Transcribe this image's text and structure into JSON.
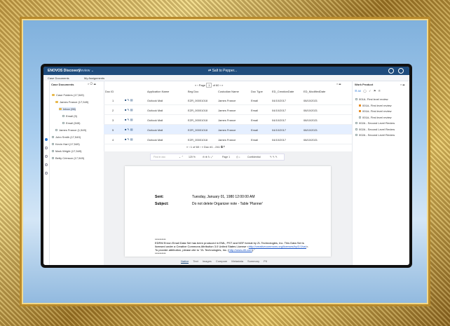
{
  "app": {
    "name": "ENOVOS Discovery",
    "review_label": "Review",
    "center_title": "Salt to Pepper..."
  },
  "tabs": [
    "Case Documents",
    "My Assignments"
  ],
  "left_panel": {
    "title": "Case Documents",
    "tree": [
      {
        "label": "Case Folders (17,549)",
        "type": "folder"
      },
      {
        "label": "James France (17,549)",
        "type": "folder"
      },
      {
        "label": "Inbox (96)",
        "type": "folder",
        "selected": true
      },
      {
        "label": "Email (9)",
        "type": "box"
      },
      {
        "label": "Email (545)",
        "type": "box"
      },
      {
        "label": "James France (1,549)",
        "type": "box"
      },
      {
        "label": "John Smith (17,549)",
        "type": "box"
      },
      {
        "label": "Kevin Hart (17,549)",
        "type": "box"
      },
      {
        "label": "Mark Wright (17,549)",
        "type": "box"
      },
      {
        "label": "Betty Crimson (17,549)",
        "type": "box"
      }
    ]
  },
  "pager_top": {
    "prefix": "Page",
    "page": "1",
    "of": "of 60"
  },
  "table": {
    "headers": [
      "Doc ID",
      "Application Name",
      "Beg Doc",
      "Custodian Name",
      "Doc Type",
      "ED_CreationDate",
      "ED_ModifiedDate"
    ],
    "rows": [
      {
        "id": "1",
        "app": "Outlook Mail",
        "beg": "EZR_00001018",
        "cust": "James France",
        "type": "Email",
        "created": "04/10/2017",
        "modified": "08/10/2021"
      },
      {
        "id": "2",
        "app": "Outlook Mail",
        "beg": "EZR_00001018",
        "cust": "James France",
        "type": "Email",
        "created": "04/10/2017",
        "modified": "08/10/2021"
      },
      {
        "id": "3",
        "app": "Outlook Mail",
        "beg": "EZR_00001018",
        "cust": "James France",
        "type": "Email",
        "created": "04/10/2017",
        "modified": "08/10/2021"
      },
      {
        "id": "5",
        "app": "Outlook Mail",
        "beg": "EZR_00001018",
        "cust": "James France",
        "type": "Email",
        "created": "04/10/2017",
        "modified": "08/10/2021"
      },
      {
        "id": "4",
        "app": "Outlook Mail",
        "beg": "EZR_00001018",
        "cust": "James France",
        "type": "Email",
        "created": "04/10/2017",
        "modified": "08/10/2021"
      }
    ]
  },
  "pager_doc": {
    "page": "1",
    "of": "of 60",
    "doc": "Doc #1 - 241"
  },
  "viewer": {
    "find_placeholder": "Find in doc",
    "zoom": "120 %",
    "page_label": "Page 1",
    "confidential": "Confidential",
    "sent_label": "Sent:",
    "sent_value": "Tuesday, January 01, 1980 12:00:00 AM",
    "subject_label": "Subject:",
    "subject_value": "Do not delete Organizer note - Table 'Planner'",
    "stars": "**********",
    "body1": "EDRM Enron Email Data Set has been produced in EML, PST and NSF format by ZL Technologies, Inc. This Data Set is licensed under a Creative Commons Attribution 3.0 United States License <",
    "link1": "http://creativecommons.org/licenses/by/3.0/us/",
    "body2": ">. To provide attribution, please cite to \"ZL Technologies, Inc. (",
    "link2": "http://www.zlti.com",
    "body3": ").\"",
    "stars2": "**********",
    "tabs": [
      "Native",
      "Text",
      "Images",
      "Compare",
      "Metadata",
      "Summary",
      "PII"
    ]
  },
  "right_panel": {
    "title": "Work Product",
    "tab_all": "All",
    "items": [
      {
        "label": "001A- First level review",
        "checked": false,
        "indent": 0
      },
      {
        "label": "001A- First level review",
        "checked": true,
        "indent": 1
      },
      {
        "label": "001A- First level review",
        "checked": true,
        "indent": 1
      },
      {
        "label": "001A- First level review",
        "checked": false,
        "indent": 1
      },
      {
        "label": "002A - Second Level Review",
        "checked": false,
        "indent": 0
      },
      {
        "label": "002A - Second Level Review",
        "checked": false,
        "indent": 0
      },
      {
        "label": "002A - Second Level Review",
        "checked": false,
        "indent": 0
      }
    ]
  },
  "colors": {
    "topbar": "#1f4c7d",
    "highlight_row": "#e5efff",
    "accent_orange": "#e8902a"
  }
}
